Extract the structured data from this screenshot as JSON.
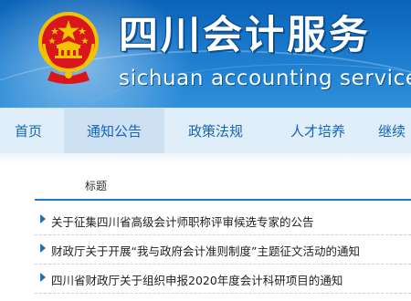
{
  "header": {
    "title_cn": "四川会计服务",
    "title_en": "sichuan accounting service",
    "emblem_icon": "national-emblem-icon"
  },
  "nav": {
    "items": [
      {
        "label": "首页"
      },
      {
        "label": "通知公告",
        "active": true
      },
      {
        "label": "政策法规"
      },
      {
        "label": "人才培养"
      },
      {
        "label": "继续"
      }
    ]
  },
  "list": {
    "column_header": "标题",
    "items": [
      {
        "title": "关于征集四川省高级会计师职称评审候选专家的公告"
      },
      {
        "title": "财政厅关于开展“我与政府会计准则制度”主题征文活动的通知"
      },
      {
        "title": "四川省财政厅关于组织申报2020年度会计科研项目的通知"
      }
    ]
  },
  "colors": {
    "brand_blue": "#1d7ed0",
    "nav_bg": "#dfeef9",
    "nav_text": "#1565b8",
    "emblem_red": "#d8161b",
    "emblem_gold": "#f2c300"
  }
}
